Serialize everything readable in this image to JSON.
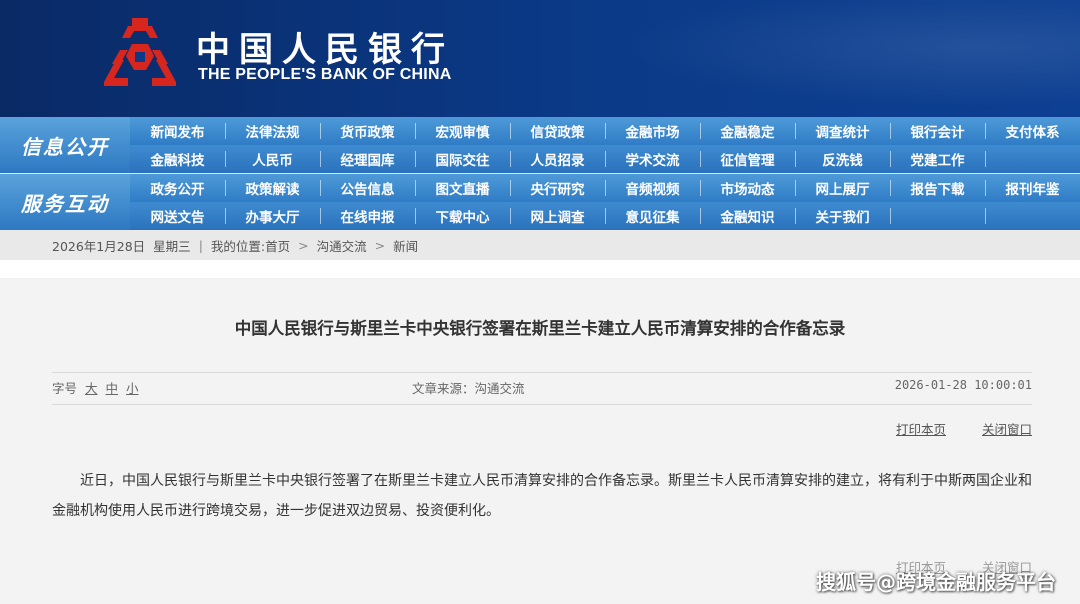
{
  "header": {
    "bank_name_cn": "中国人民银行",
    "bank_name_en": "THE PEOPLE'S BANK OF CHINA",
    "logo_icon": "pboc-logo-icon",
    "colors": {
      "banner": "#0b3a88",
      "logo": "#d7261e",
      "nav": "#2f7cc6"
    }
  },
  "nav": {
    "groups": [
      {
        "label": "信息公开",
        "rows": [
          [
            "新闻发布",
            "法律法规",
            "货币政策",
            "宏观审慎",
            "信贷政策",
            "金融市场",
            "金融稳定",
            "调查统计",
            "银行会计",
            "支付体系"
          ],
          [
            "金融科技",
            "人民币",
            "经理国库",
            "国际交往",
            "人员招录",
            "学术交流",
            "征信管理",
            "反洗钱",
            "党建工作",
            ""
          ]
        ]
      },
      {
        "label": "服务互动",
        "rows": [
          [
            "政务公开",
            "政策解读",
            "公告信息",
            "图文直播",
            "央行研究",
            "音频视频",
            "市场动态",
            "网上展厅",
            "报告下载",
            "报刊年鉴"
          ],
          [
            "网送文告",
            "办事大厅",
            "在线申报",
            "下载中心",
            "网上调查",
            "意见征集",
            "金融知识",
            "关于我们",
            "",
            ""
          ]
        ]
      }
    ]
  },
  "breadcrumb": {
    "date": "2026年1月28日",
    "weekday": "星期三",
    "location_label": "我的位置:",
    "items": [
      "首页",
      "沟通交流",
      "新闻"
    ],
    "separator": "|",
    "arrow": ">"
  },
  "article": {
    "title": "中国人民银行与斯里兰卡中央银行签署在斯里兰卡建立人民币清算安排的合作备忘录",
    "font_size_label": "字号",
    "font_sizes": [
      "大",
      "中",
      "小"
    ],
    "source": "文章来源：沟通交流",
    "datetime": "2026-01-28 10:00:01",
    "print_label": "打印本页",
    "close_label": "关闭窗口",
    "body": "近日，中国人民银行与斯里兰卡中央银行签署了在斯里兰卡建立人民币清算安排的合作备忘录。斯里兰卡人民币清算安排的建立，将有利于中斯两国企业和金融机构使用人民币进行跨境交易，进一步促进双边贸易、投资便利化。"
  },
  "watermark": "搜狐号@跨境金融服务平台"
}
